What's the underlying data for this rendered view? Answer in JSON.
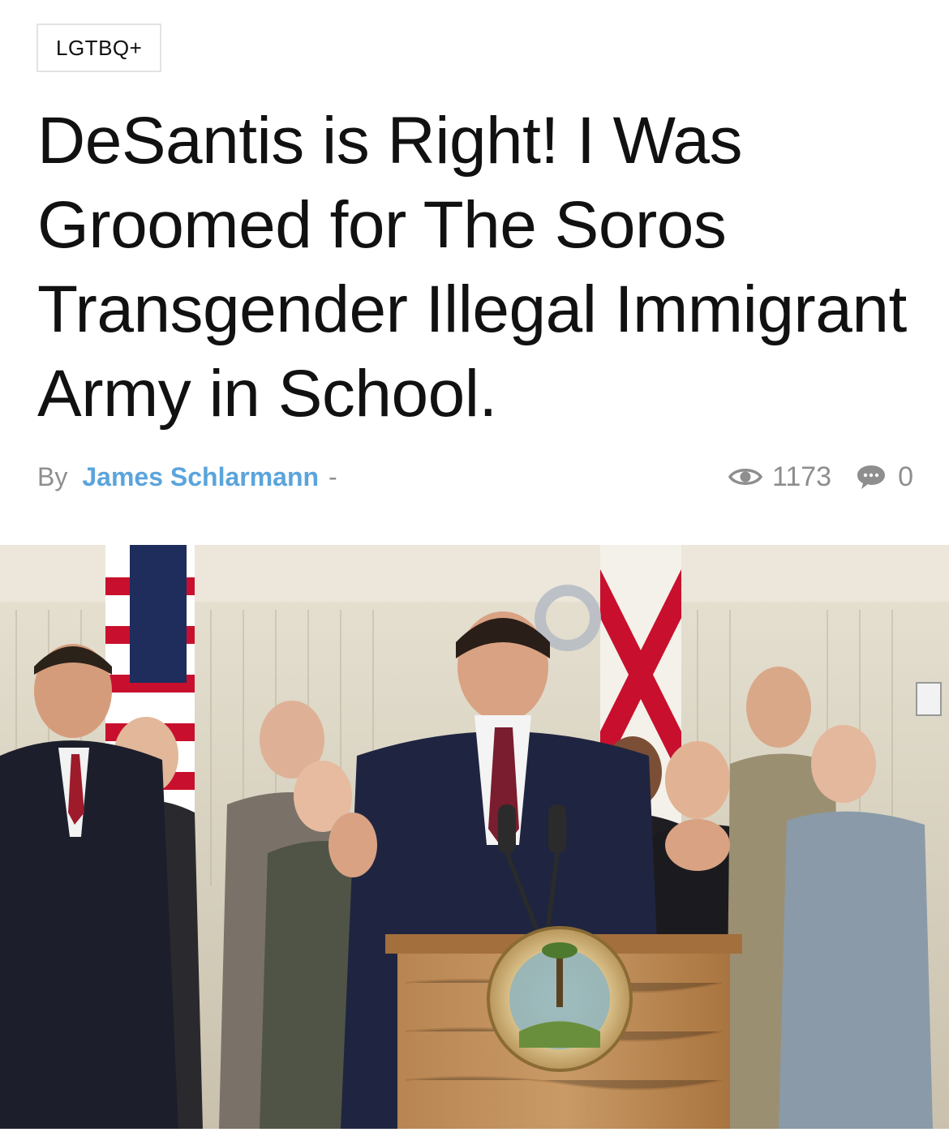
{
  "article": {
    "category": "LGTBQ+",
    "title": "DeSantis is Right! I Was Groomed for The Soros Transgender Illegal Immigrant Army in School.",
    "byline": {
      "by_label": "By",
      "author": "James Schlarmann",
      "separator": "-"
    },
    "stats": {
      "views_icon": "eye-icon",
      "views": "1173",
      "comments_icon": "speech-bubble-icon",
      "comments": "0"
    }
  },
  "colors": {
    "author_link": "#5ba4dc",
    "muted_text": "#8e8e8e",
    "headline": "#111111",
    "tag_border": "#e3e3e3"
  }
}
